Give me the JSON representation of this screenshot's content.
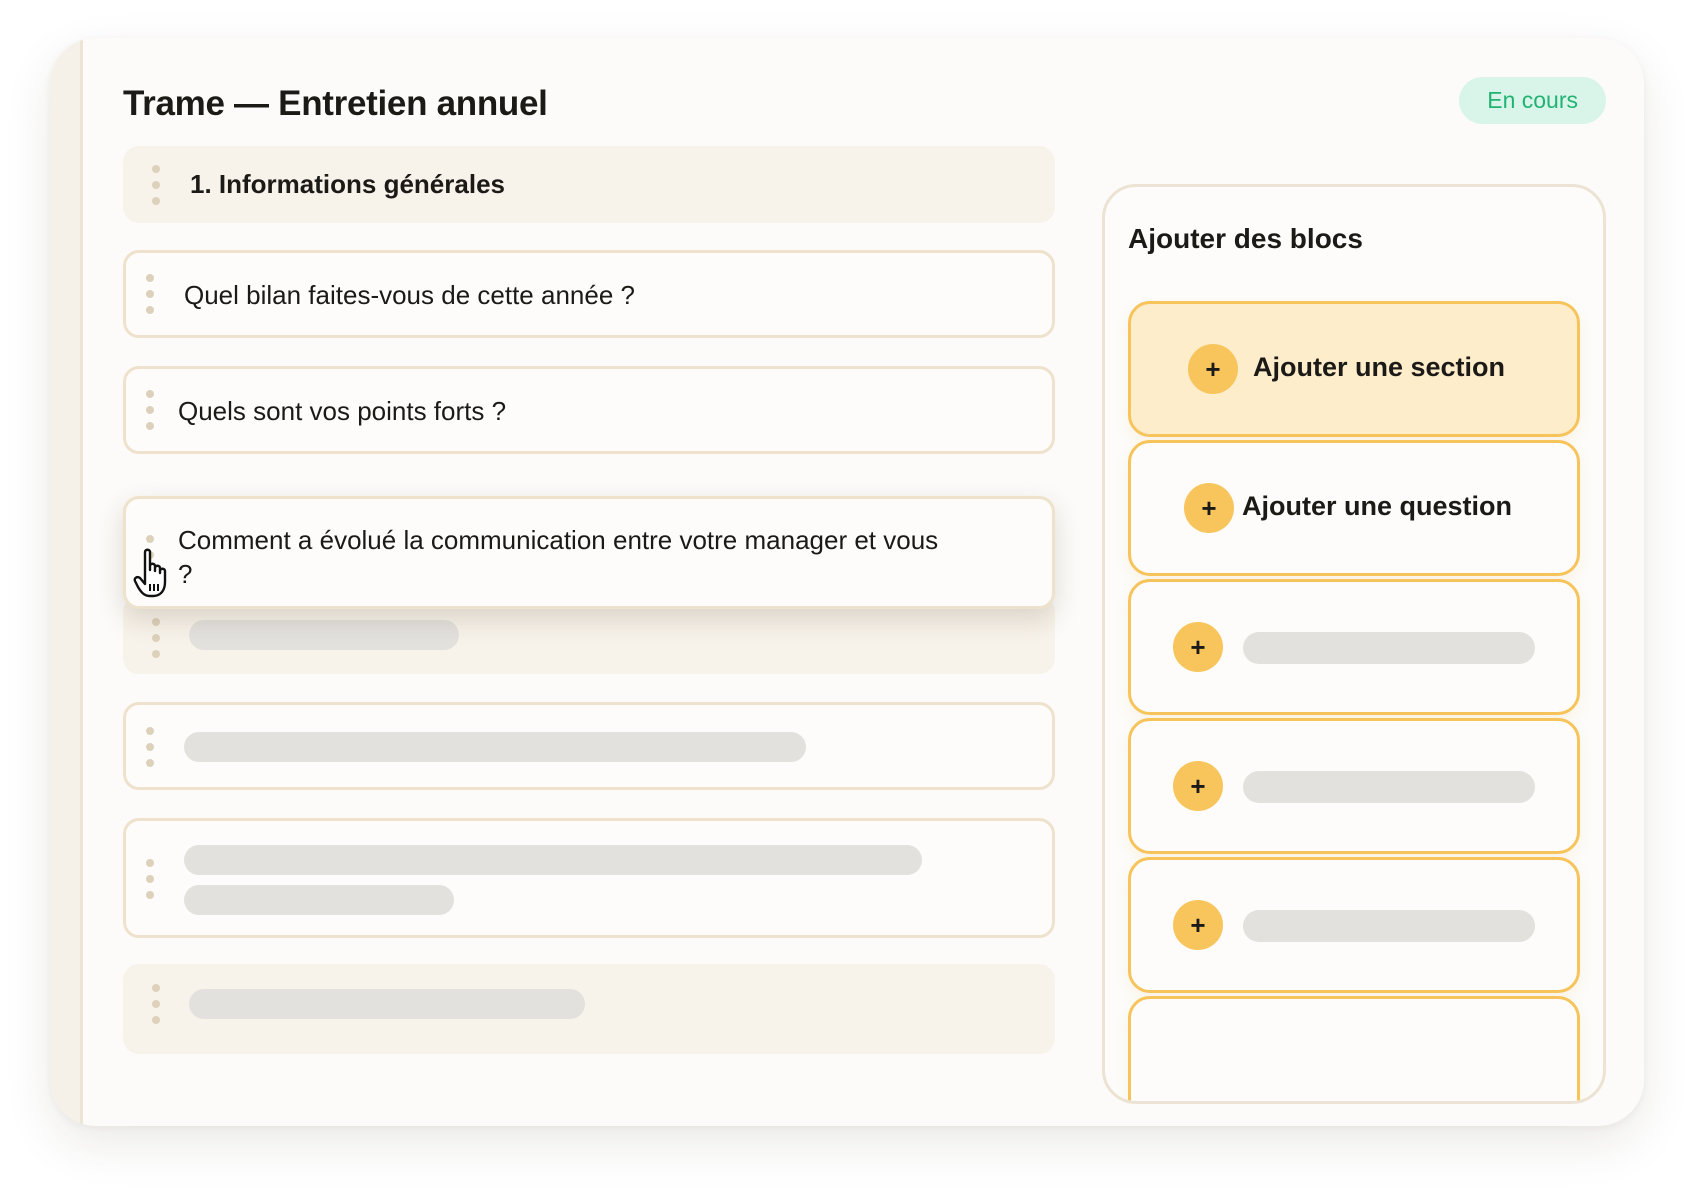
{
  "header": {
    "title": "Trame — Entretien annuel",
    "status": "En cours"
  },
  "blocks": {
    "section_1": "1. Informations générales",
    "question_1": "Quel bilan faites-vous de cette année ?",
    "question_2": "Quels sont vos points forts ?",
    "question_dragging": "Comment a évolué la communication entre votre manager et vous ?"
  },
  "panel": {
    "title": "Ajouter des blocs",
    "items": [
      {
        "label": "Ajouter une section",
        "icon": "plus-icon"
      },
      {
        "label": "Ajouter une question",
        "icon": "plus-icon"
      }
    ]
  },
  "colors": {
    "accent": "#f8c55d",
    "accent_light": "#feedcb",
    "status_bg": "#d9f5ea",
    "status_text": "#22b373"
  }
}
